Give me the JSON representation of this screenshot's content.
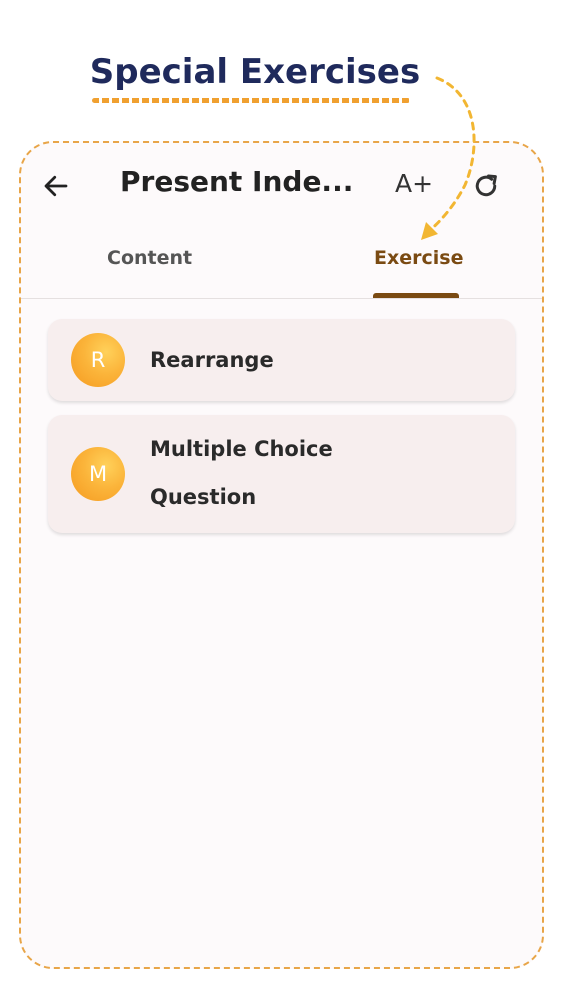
{
  "promo": {
    "headline": "Special Exercises"
  },
  "header": {
    "title": "Present Inde...",
    "font_size_label": "A+"
  },
  "tabs": [
    {
      "label": "Content",
      "selected": false
    },
    {
      "label": "Exercise",
      "selected": true
    }
  ],
  "exercises": [
    {
      "initial": "R",
      "label": "Rearrange"
    },
    {
      "initial": "M",
      "label": "Multiple Choice Question"
    }
  ],
  "colors": {
    "headline": "#1f2a5c",
    "accent_dashed": "#e8a548",
    "selected_tab": "#7a4a12",
    "avatar": "#fbb43a",
    "card_bg": "#f7eeee"
  },
  "icons": {
    "back": "arrow-left-icon",
    "refresh": "refresh-icon"
  }
}
